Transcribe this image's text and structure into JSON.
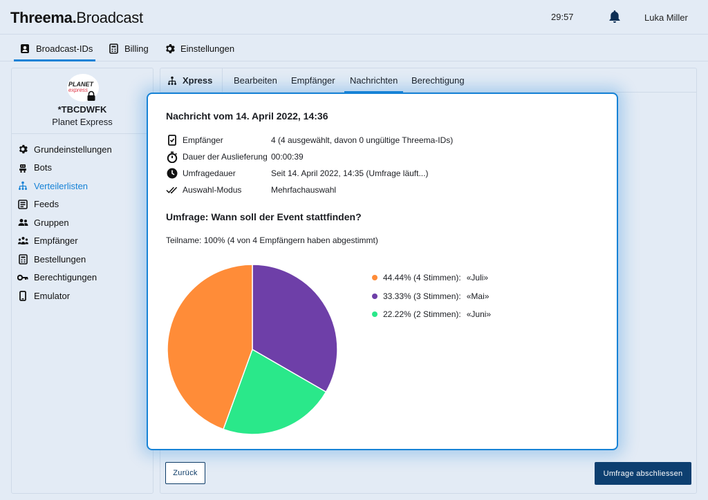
{
  "app": {
    "brand_bold": "Threema.",
    "brand_light": "Broadcast",
    "clock": "29:57",
    "user_name": "Luka Miller"
  },
  "topnav": [
    {
      "label": "Broadcast-IDs",
      "icon": "id-card-icon"
    },
    {
      "label": "Billing",
      "icon": "invoice-icon"
    },
    {
      "label": "Einstellungen",
      "icon": "gear-icon"
    }
  ],
  "profile": {
    "id": "*TBCDWFK",
    "name": "Planet Express",
    "logo_line1": "PLANET",
    "logo_line2": "express"
  },
  "sidebar": [
    {
      "label": "Grundeinstellungen",
      "icon": "gear-icon"
    },
    {
      "label": "Bots",
      "icon": "robot-icon"
    },
    {
      "label": "Verteilerlisten",
      "icon": "distribution-icon"
    },
    {
      "label": "Feeds",
      "icon": "feed-icon"
    },
    {
      "label": "Gruppen",
      "icon": "group-icon"
    },
    {
      "label": "Empfänger",
      "icon": "recipients-icon"
    },
    {
      "label": "Bestellungen",
      "icon": "orders-icon"
    },
    {
      "label": "Berechtigungen",
      "icon": "key-icon"
    },
    {
      "label": "Emulator",
      "icon": "phone-icon"
    }
  ],
  "subtabs": {
    "section": "Xpress",
    "items": [
      "Bearbeiten",
      "Empfänger",
      "Nachrichten",
      "Berechtigung"
    ]
  },
  "message": {
    "title": "Nachricht vom 14. April 2022, 14:36",
    "rows": [
      {
        "label": "Empfänger",
        "value": "4 (4 ausgewählt, davon 0 ungültige Threema-IDs)",
        "icon": "phone-check-icon"
      },
      {
        "label": "Dauer der Auslieferung",
        "value": "00:00:39",
        "icon": "stopwatch-icon"
      },
      {
        "label": "Umfragedauer",
        "value": "Seit 14. April 2022, 14:35 (Umfrage läuft...)",
        "icon": "clock-icon"
      },
      {
        "label": "Auswahl-Modus",
        "value": "Mehrfachauswahl",
        "icon": "double-check-icon"
      }
    ],
    "poll_title": "Umfrage: Wann soll der Event stattfinden?",
    "participation": "Teilname: 100% (4 von 4 Empfängern haben abgestimmt)"
  },
  "chart_data": {
    "type": "pie",
    "slices": [
      {
        "label": "«Juli»",
        "percent": 44.44,
        "votes_text": "44.44% (4 Stimmen):",
        "color": "#ff8c38"
      },
      {
        "label": "«Mai»",
        "percent": 33.33,
        "votes_text": "33.33% (3 Stimmen):",
        "color": "#6e3fa8"
      },
      {
        "label": "«Juni»",
        "percent": 22.22,
        "votes_text": "22.22% (2 Stimmen):",
        "color": "#2ae88a"
      }
    ]
  },
  "buttons": {
    "back": "Zurück",
    "close_poll": "Umfrage abschliessen"
  },
  "colors": {
    "accent": "#1682d6",
    "primary_dark": "#0d3f70",
    "background": "#e3ebf5"
  }
}
